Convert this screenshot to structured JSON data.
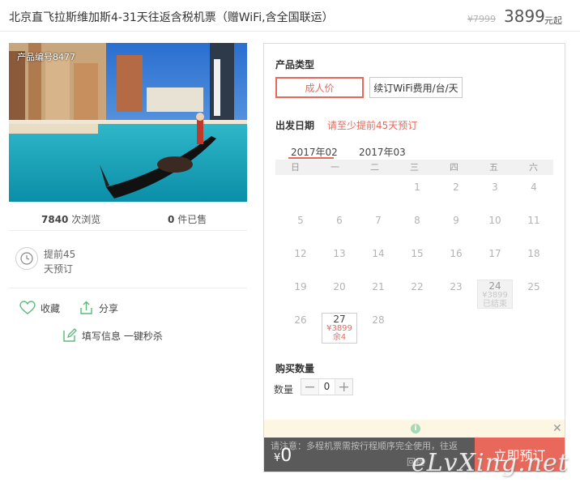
{
  "header": {
    "title": "北京直飞拉斯维加斯4-31天往返含税机票（赠WiFi,含全国联运）",
    "old_price": "¥7999",
    "price": "3899",
    "price_unit": "元起"
  },
  "product": {
    "code": "产品编号8477",
    "views_count": "7840",
    "views_label": "次浏览",
    "sold_count": "0",
    "sold_label": "件已售",
    "booking_line1": "提前45",
    "booking_line2": "天预订",
    "favorite_label": "收藏",
    "share_label": "分享",
    "fill_info_label": "填写信息 一键秒杀"
  },
  "panel": {
    "product_type_title": "产品类型",
    "product_types": [
      "成人价",
      "续订WiFi费用/台/天"
    ],
    "selected_type": "成人价",
    "date_title": "出发日期",
    "date_hint": "请至少提前45天预订",
    "months": [
      "2017年02",
      "2017年03"
    ],
    "selected_month": "2017年02",
    "weekdays": [
      "日",
      "一",
      "二",
      "三",
      "四",
      "五",
      "六"
    ],
    "days": [
      "1",
      "2",
      "3",
      "4",
      "5",
      "6",
      "7",
      "8",
      "9",
      "10",
      "11",
      "12",
      "13",
      "14",
      "15",
      "16",
      "17",
      "18",
      "19",
      "20",
      "21",
      "22",
      "23",
      "24",
      "25",
      "26",
      "27",
      "28"
    ],
    "day24": {
      "price": "¥3899",
      "status": "已结束"
    },
    "day27": {
      "price": "¥3899",
      "remain": "余4"
    },
    "quantity_title": "购买数量",
    "quantity_label": "数量",
    "quantity_value": "0"
  },
  "notice": {
    "text": "请注意：多程机票需按行程顺序完全使用，往返",
    "text2": "回程",
    "total_currency": "¥",
    "total": "0",
    "book_button": "立即预订"
  },
  "watermark": "eLvXing.net",
  "colors": {
    "accent": "#e8695b",
    "bottom_bar": "#5a5a5a",
    "notice_bg": "#fdf6e3"
  },
  "icons": [
    "clock-icon",
    "heart-icon",
    "share-icon",
    "edit-icon",
    "info-icon",
    "close-icon",
    "minus-icon",
    "plus-icon"
  ]
}
